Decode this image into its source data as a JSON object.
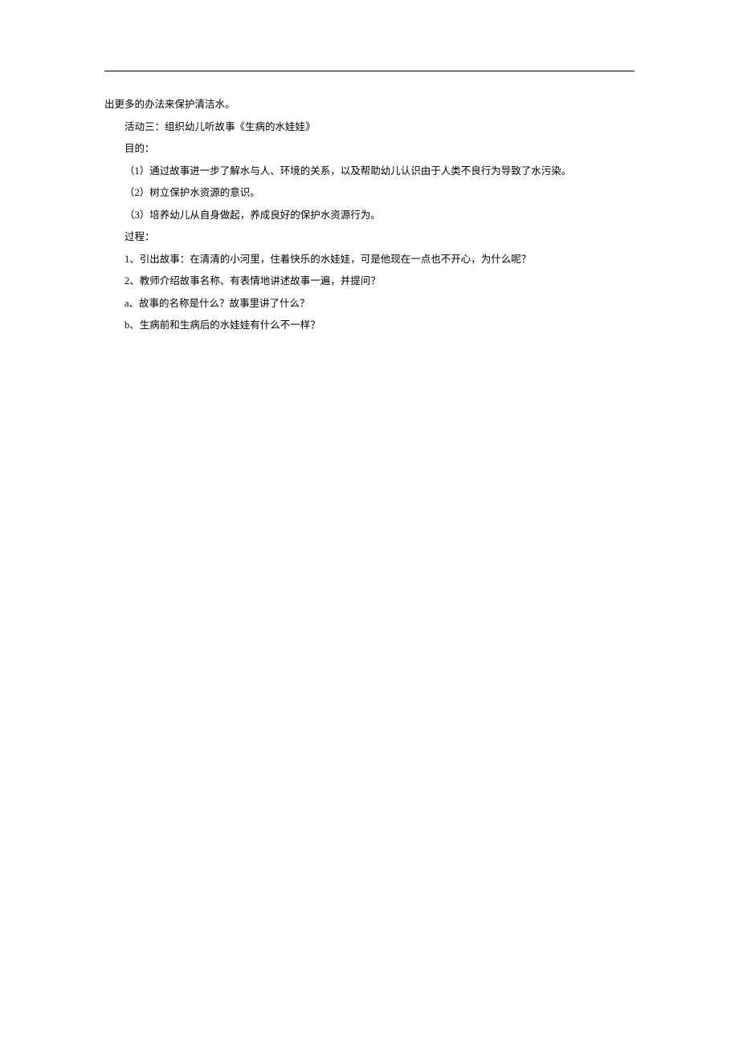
{
  "document": {
    "lines": [
      {
        "text": "出更多的办法来保护清洁水。",
        "indent": false
      },
      {
        "text": "活动三：组织幼儿听故事《生病的水娃娃》",
        "indent": true
      },
      {
        "text": "目的：",
        "indent": true
      },
      {
        "text": "（1）通过故事进一步了解水与人、环境的关系，以及帮助幼儿认识由于人类不良行为导致了水污染。",
        "indent": true
      },
      {
        "text": "（2）树立保护水资源的意识。",
        "indent": true
      },
      {
        "text": "（3）培养幼儿从自身做起，养成良好的保护水资源行为。",
        "indent": true
      },
      {
        "text": "过程：",
        "indent": true
      },
      {
        "text": "1、引出故事：在清清的小河里，住着快乐的水娃娃，可是他现在一点也不开心，为什么呢？",
        "indent": true
      },
      {
        "text": "2、教师介绍故事名称、有表情地讲述故事一遍，并提问？",
        "indent": true
      },
      {
        "text": "a、故事的名称是什么？故事里讲了什么？",
        "indent": true
      },
      {
        "text": "b、生病前和生病后的水娃娃有什么不一样？",
        "indent": true
      }
    ]
  }
}
